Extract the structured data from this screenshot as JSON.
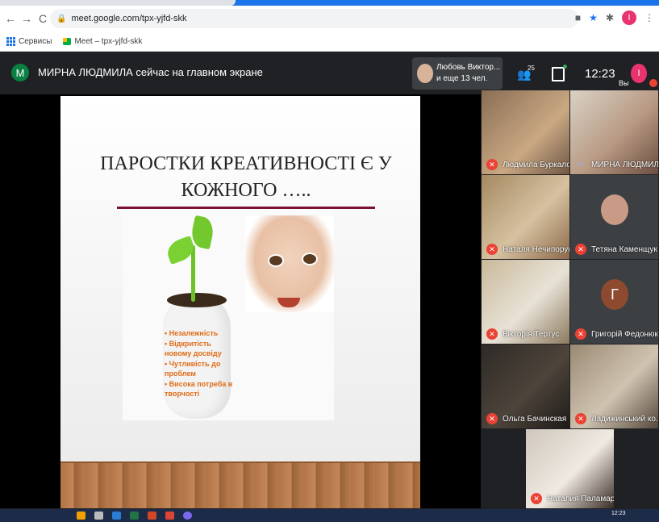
{
  "browser": {
    "url": "meet.google.com/tpx-yjfd-skk",
    "profile_initial": "I",
    "bookmarks": [
      {
        "label": "Сервисы",
        "icon": "apps-icon"
      },
      {
        "label": "Meet – tpx-yjfd-skk",
        "icon": "meet-icon"
      }
    ]
  },
  "meeting": {
    "presenter_initial": "M",
    "presenting_text": "МИРНА ЛЮДМИЛА сейчас на главном экране",
    "hand_raise": {
      "line1": "Любовь Виктор...",
      "line2": "и еще 13 чел."
    },
    "participants_count": "25",
    "clock": "12:23",
    "self_label": "Вы",
    "self_initial": "I"
  },
  "slide": {
    "title": "ПАРОСТКИ КРЕАТИВНОСТІ  Є У КОЖНОГО …..",
    "bullets": [
      "Незалежність",
      "Відкритість новому досвіду",
      "Чутливість  до проблем",
      "Висока  потреба в творчості"
    ]
  },
  "participants": [
    {
      "name": "Людмила Буркало",
      "muted": true
    },
    {
      "name": "МИРНА ЛЮДМИЛА",
      "muted": false
    },
    {
      "name": "Наталя Нечипорук",
      "muted": true
    },
    {
      "name": "Тетяна Каменщук",
      "muted": true
    },
    {
      "name": "Вікторія Тертус",
      "muted": true
    },
    {
      "name": "Григорій Федонюк",
      "muted": true,
      "initial": "Г"
    },
    {
      "name": "Ольга Бачинская",
      "muted": true
    },
    {
      "name": "Ладижинський ко...",
      "muted": true
    },
    {
      "name": "Наталия Паламар...",
      "muted": true
    }
  ],
  "taskbar": {
    "time": "12:23"
  },
  "colors": {
    "accent": "#1a73e8",
    "mic_off": "#ea4335",
    "slide_rule": "#7b1232",
    "bullet_text": "#e06c16"
  }
}
